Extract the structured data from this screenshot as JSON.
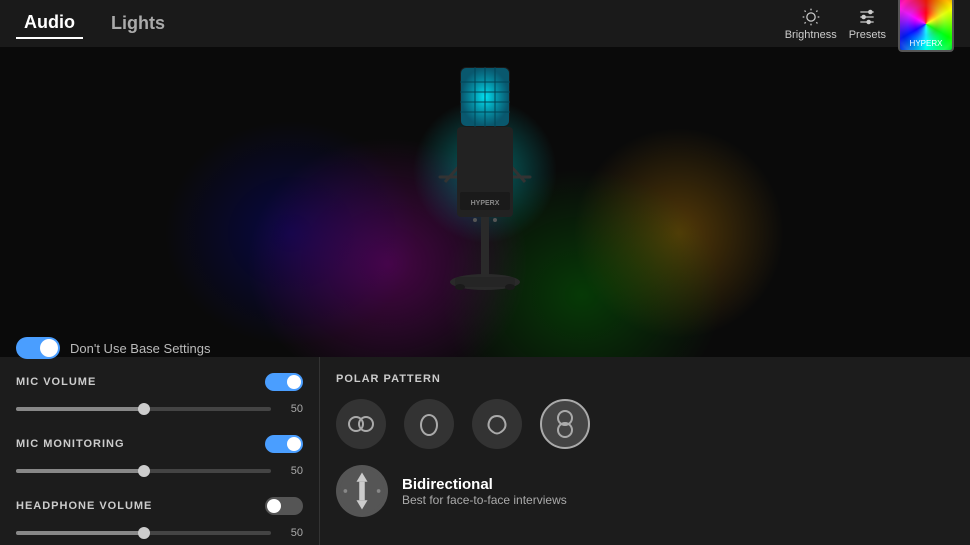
{
  "header": {
    "tab_audio": "Audio",
    "tab_lights": "Lights",
    "brightness_label": "Brightness",
    "presets_label": "Presets"
  },
  "base_toggle": {
    "label": "Don't Use Base Settings",
    "enabled": true
  },
  "mic_volume": {
    "label": "MIC VOLUME",
    "enabled": true,
    "value": 50,
    "value_str": "50",
    "fill_pct": 50
  },
  "mic_monitoring": {
    "label": "MIC MONITORING",
    "enabled": true,
    "value": 50,
    "value_str": "50",
    "fill_pct": 50
  },
  "headphone_volume": {
    "label": "HEADPHONE VOLUME",
    "enabled": false,
    "value": 50,
    "value_str": "50",
    "fill_pct": 50
  },
  "polar_pattern": {
    "label": "POLAR PATTERN",
    "patterns": [
      "stereo",
      "cardioid",
      "omnidirectional",
      "bidirectional"
    ],
    "active_index": 3,
    "selected": {
      "name": "Bidirectional",
      "description": "Best for face-to-face interviews"
    }
  }
}
